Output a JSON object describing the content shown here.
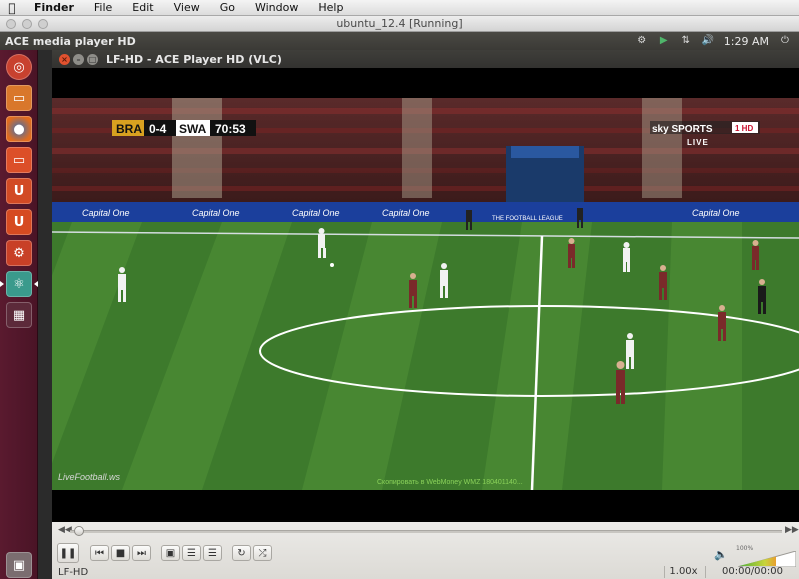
{
  "mac_menubar": {
    "apple": "",
    "items": [
      "Finder",
      "File",
      "Edit",
      "View",
      "Go",
      "Window",
      "Help"
    ]
  },
  "vbox_window": {
    "title": "ubuntu_12.4 [Running]"
  },
  "ubuntu_panel": {
    "app_title": "ACE media player HD",
    "clock": "1:29 AM",
    "tray_icons": [
      "network-icon",
      "ace-stream-icon",
      "transfer-arrows-icon",
      "volume-icon",
      "session-gear-icon"
    ]
  },
  "launcher": {
    "items": [
      {
        "name": "dash-home",
        "color": "#c8412f",
        "glyph": "◎"
      },
      {
        "name": "files",
        "color": "#d9772b",
        "glyph": "▭"
      },
      {
        "name": "firefox",
        "color": "#e06c1f",
        "glyph": "●"
      },
      {
        "name": "software-center",
        "color": "#dc4f28",
        "glyph": "⬚"
      },
      {
        "name": "ubuntu-one",
        "color": "#d24a24",
        "glyph": "U"
      },
      {
        "name": "ubuntu-one-music",
        "color": "#d64a21",
        "glyph": "U"
      },
      {
        "name": "system-settings",
        "color": "#c84027",
        "glyph": "⚙"
      },
      {
        "name": "ace-player",
        "color": "#3a9a8c",
        "glyph": "⛛"
      },
      {
        "name": "workspace-switcher",
        "color": "#5c2a3a",
        "glyph": "▦"
      },
      {
        "name": "trash",
        "color": "#7b6d70",
        "glyph": "🗑"
      }
    ]
  },
  "vlc": {
    "title": "LF-HD - ACE Player HD (VLC)",
    "scoreboard": {
      "home": "BRA",
      "score": "0-4",
      "away": "SWA",
      "clock": "70:53"
    },
    "broadcaster": {
      "logo_text": "sky SPORTS",
      "channel": "1 HD",
      "live": "LIVE"
    },
    "watermark": "LiveFootball.ws",
    "ticker": "Скопировать в WebMoney WMZ 180401140...",
    "ad_boards": [
      "Capital One",
      "Capital One",
      "Capital One",
      "Capital One",
      "THE FOOTBALL LEAGUE",
      "Capital One"
    ],
    "controls": {
      "play_pause_icon": "pause-icon",
      "volume_percent": "100%"
    },
    "status": {
      "stream_name": "LF-HD",
      "rate": "1.00x",
      "time": "00:00/00:00"
    }
  },
  "colors": {
    "pitch_dark": "#3d7a2c",
    "pitch_light": "#4a8a34",
    "home_kit": "#f2f2f2",
    "away_kit": "#7a2a2a",
    "ubuntu_orange": "#dd4814"
  }
}
